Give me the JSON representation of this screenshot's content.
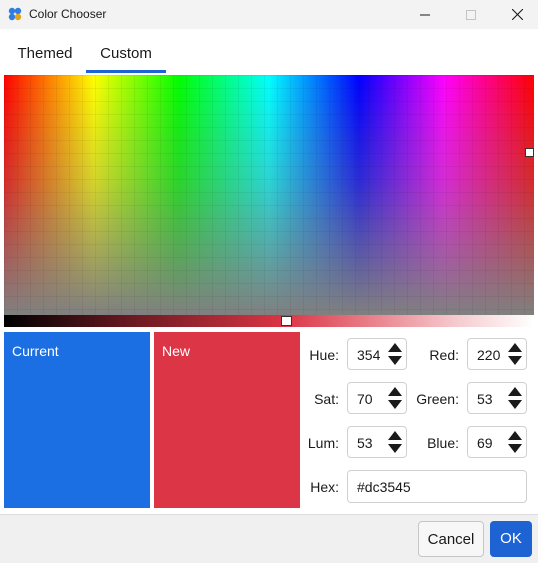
{
  "window": {
    "title": "Color Chooser",
    "icon": "color-palette-icon"
  },
  "tabs": [
    {
      "label": "Themed",
      "active": false
    },
    {
      "label": "Custom",
      "active": true
    }
  ],
  "preview": {
    "current_label": "Current",
    "new_label": "New",
    "current_color": "#1b6fe3",
    "new_color": "#dc3545"
  },
  "fields": {
    "hue": {
      "label": "Hue:",
      "value": "354"
    },
    "sat": {
      "label": "Sat:",
      "value": "70"
    },
    "lum": {
      "label": "Lum:",
      "value": "53"
    },
    "red": {
      "label": "Red:",
      "value": "220"
    },
    "green": {
      "label": "Green:",
      "value": "53"
    },
    "blue": {
      "label": "Blue:",
      "value": "69"
    },
    "hex": {
      "label": "Hex:",
      "value": "#dc3545"
    }
  },
  "buttons": {
    "cancel": "Cancel",
    "ok": "OK"
  },
  "colors": {
    "accent": "#1d63d4",
    "selected": "#dc3545",
    "current": "#1b6fe3"
  }
}
